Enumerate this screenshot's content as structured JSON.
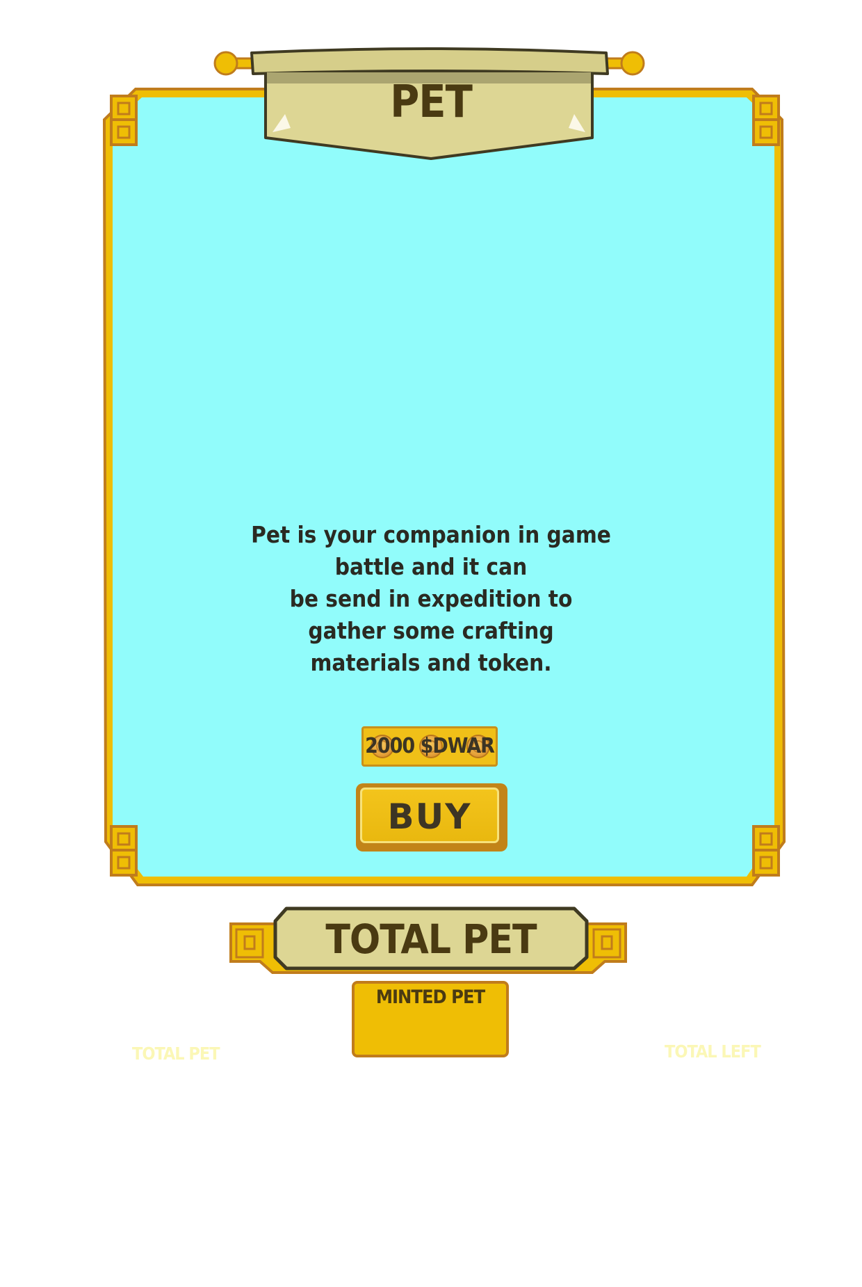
{
  "panel": {
    "title": "PET",
    "description_lines": [
      "Pet is your companion in game",
      "battle and it can",
      "be send in expedition to",
      "gather some crafting",
      "materials and token."
    ]
  },
  "price": {
    "label": "2000 $DWAR"
  },
  "buy_button": {
    "label": "BUY"
  },
  "stats": {
    "banner_title": "TOTAL PET",
    "minted_label": "MINTED PET",
    "total_pet_label": "TOTAL PET",
    "total_left_label": "TOTAL LEFT"
  },
  "colors": {
    "panel_fill": "#91fcfb",
    "gold": "#efbe05",
    "gold_border": "#c07c1c",
    "scroll": "#ddd694",
    "text_dark": "#4a3a12"
  }
}
